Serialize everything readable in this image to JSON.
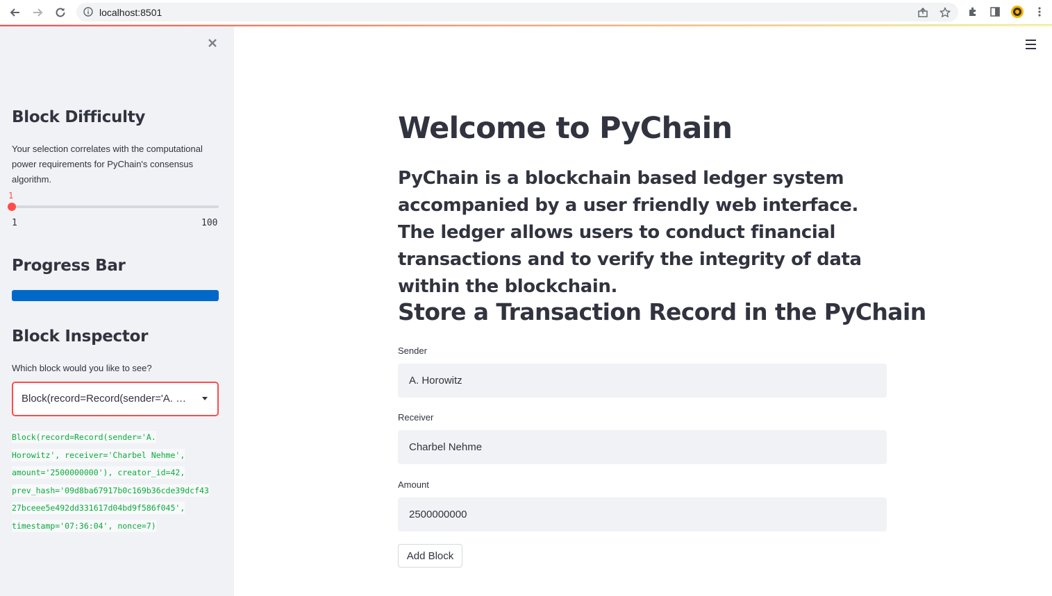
{
  "browser": {
    "url": "localhost:8501"
  },
  "sidebar": {
    "close_icon": "close-icon",
    "block_difficulty": {
      "title": "Block Difficulty",
      "description": "Your selection correlates with the computational power requirements for PyChain's consensus algorithm.",
      "slider_value": "1",
      "slider_min": "1",
      "slider_max": "100"
    },
    "progress_bar": {
      "title": "Progress Bar",
      "progress": 1.0,
      "fill_color": "#0068c9"
    },
    "block_inspector": {
      "title": "Block Inspector",
      "prompt": "Which block would you like to see?",
      "selected": "Block(record=Record(sender='A. Horowitz', receiver='Charbel Nehme', amount='2500000000'), creator_id=42, prev_hash='09d8ba67917b0c169b36cde39dcf4327bceee5e492dd331617d04bd9f586f045', timestamp='07:36:04', nonce=7)",
      "output_lines": [
        "Block(record=Record(sender='A.",
        "Horowitz', receiver='Charbel Nehme',",
        "amount='2500000000'), creator_id=42,",
        "prev_hash='09d8ba67917b0c169b36cde39dcf43",
        "27bceee5e492dd331617d04bd9f586f045',",
        "timestamp='07:36:04', nonce=7)"
      ]
    }
  },
  "main": {
    "title": "Welcome to PyChain",
    "intro": "PyChain is a blockchain based ledger system accompanied by a user friendly web interface. The ledger allows users to conduct financial transactions and to verify the integrity of data within the blockchain.",
    "section_title": "Store a Transaction Record in the PyChain",
    "fields": {
      "sender_label": "Sender",
      "sender_value": "A. Horowitz",
      "receiver_label": "Receiver",
      "receiver_value": "Charbel Nehme",
      "amount_label": "Amount",
      "amount_value": "2500000000"
    },
    "add_button": "Add Block"
  },
  "colors": {
    "accent": "#ff4b4b",
    "code": "#09ab3b",
    "sidebar_bg": "#f0f2f6"
  }
}
